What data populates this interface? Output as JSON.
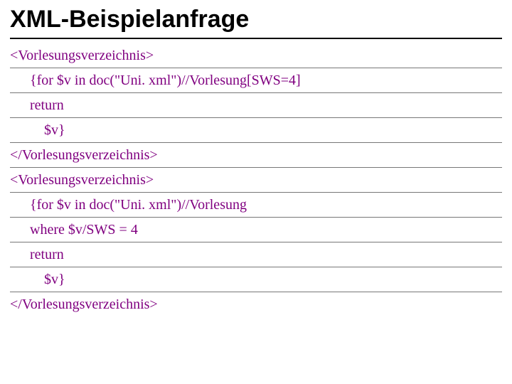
{
  "title": "XML-Beispielanfrage",
  "lines": {
    "l0": "<Vorlesungsverzeichnis>",
    "l1": "{for $v in doc(\"Uni. xml\")//Vorlesung[SWS=4]",
    "l2": "return",
    "l3": "$v}",
    "l4": "</Vorlesungsverzeichnis>",
    "l5": "<Vorlesungsverzeichnis>",
    "l6": "{for $v in doc(\"Uni. xml\")//Vorlesung",
    "l7": "where $v/SWS = 4",
    "l8": "return",
    "l9": "$v}",
    "l10": "</Vorlesungsverzeichnis>"
  }
}
